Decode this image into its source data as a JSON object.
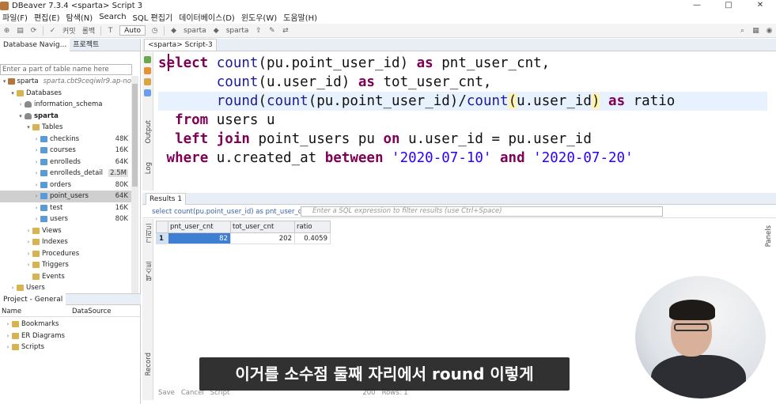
{
  "window": {
    "title": "DBeaver 7.3.4  <sparta> Script 3",
    "controls": [
      "—",
      "□",
      "✕"
    ]
  },
  "menu": [
    "파일(F)",
    "편집(E)",
    "탐색(N)",
    "Search",
    "SQL 편집기",
    "데이터베이스(D)",
    "윈도우(W)",
    "도움말(H)"
  ],
  "toolbar": {
    "commit_label": "커밋",
    "rollback_label": "롤백",
    "tx_mode": "Auto",
    "datasource": "sparta",
    "schema": "sparta"
  },
  "navigator": {
    "tabs": [
      "Database Navig...",
      "프로젝트"
    ],
    "filter_placeholder": "Enter a part of table name here",
    "tree": [
      {
        "level": 0,
        "arrow": "▾",
        "icon": "conn",
        "label": "sparta",
        "extra": "sparta.cbt9ceqiwlr9.ap-no",
        "size": ""
      },
      {
        "level": 1,
        "arrow": "▾",
        "icon": "folder",
        "label": "Databases",
        "size": ""
      },
      {
        "level": 2,
        "arrow": "›",
        "icon": "db",
        "label": "information_schema",
        "size": ""
      },
      {
        "level": 2,
        "arrow": "▾",
        "icon": "db",
        "label": "sparta",
        "size": ""
      },
      {
        "level": 3,
        "arrow": "▾",
        "icon": "folder",
        "label": "Tables",
        "size": ""
      },
      {
        "level": 4,
        "arrow": "›",
        "icon": "table",
        "label": "checkins",
        "size": "48K"
      },
      {
        "level": 4,
        "arrow": "›",
        "icon": "table",
        "label": "courses",
        "size": "16K"
      },
      {
        "level": 4,
        "arrow": "›",
        "icon": "table",
        "label": "enrolleds",
        "size": "64K"
      },
      {
        "level": 4,
        "arrow": "›",
        "icon": "table",
        "label": "enrolleds_detail",
        "size": "2.5M"
      },
      {
        "level": 4,
        "arrow": "›",
        "icon": "table",
        "label": "orders",
        "size": "80K"
      },
      {
        "level": 4,
        "arrow": "›",
        "icon": "table",
        "label": "point_users",
        "size": "64K"
      },
      {
        "level": 4,
        "arrow": "›",
        "icon": "table",
        "label": "test",
        "size": "16K"
      },
      {
        "level": 4,
        "arrow": "›",
        "icon": "table",
        "label": "users",
        "size": "80K"
      },
      {
        "level": 3,
        "arrow": "›",
        "icon": "folder",
        "label": "Views",
        "size": ""
      },
      {
        "level": 3,
        "arrow": "›",
        "icon": "folder",
        "label": "Indexes",
        "size": ""
      },
      {
        "level": 3,
        "arrow": "›",
        "icon": "folder",
        "label": "Procedures",
        "size": ""
      },
      {
        "level": 3,
        "arrow": "›",
        "icon": "folder",
        "label": "Triggers",
        "size": ""
      },
      {
        "level": 3,
        "arrow": "",
        "icon": "folder",
        "label": "Events",
        "size": ""
      },
      {
        "level": 1,
        "arrow": "›",
        "icon": "folder",
        "label": "Users",
        "size": ""
      }
    ]
  },
  "project": {
    "tab": "Project - General",
    "col_name": "Name",
    "col_ds": "DataSource",
    "items": [
      "Bookmarks",
      "ER Diagrams",
      "Scripts"
    ]
  },
  "editor": {
    "tab": "<sparta> Script-3",
    "side_labels": [
      "Output",
      "Log"
    ],
    "lines": [
      {
        "indent": "",
        "tokens": [
          [
            "kw",
            "select "
          ],
          [
            "fn",
            "count"
          ],
          [
            "id",
            "(pu.point_user_id) "
          ],
          [
            "kw",
            "as "
          ],
          [
            "id",
            "pnt_user_cnt,"
          ]
        ]
      },
      {
        "indent": "       ",
        "tokens": [
          [
            "fn",
            "count"
          ],
          [
            "id",
            "(u.user_id) "
          ],
          [
            "kw",
            "as "
          ],
          [
            "id",
            "tot_user_cnt,"
          ]
        ]
      },
      {
        "indent": "       ",
        "tokens": [
          [
            "fn",
            "round"
          ],
          [
            "id",
            "("
          ],
          [
            "fn",
            "count"
          ],
          [
            "id",
            "(pu.point_user_id)/"
          ],
          [
            "fn",
            "count"
          ],
          [
            "bracket",
            "("
          ],
          [
            "id",
            "u.user_id"
          ],
          [
            "bracket",
            ")"
          ],
          [
            "id",
            " "
          ],
          [
            "kw",
            "as "
          ],
          [
            "id",
            "ratio"
          ]
        ]
      },
      {
        "indent": "  ",
        "tokens": [
          [
            "kw",
            "from "
          ],
          [
            "id",
            "users u"
          ]
        ]
      },
      {
        "indent": "  ",
        "tokens": [
          [
            "kw",
            "left join "
          ],
          [
            "id",
            "point_users pu "
          ],
          [
            "kw",
            "on "
          ],
          [
            "id",
            "u.user_id = pu.user_id"
          ]
        ]
      },
      {
        "indent": " ",
        "tokens": [
          [
            "kw",
            "where "
          ],
          [
            "id",
            "u.created_at "
          ],
          [
            "kw",
            "between "
          ],
          [
            "str",
            "'2020-07-10'"
          ],
          [
            "id",
            " "
          ],
          [
            "kw",
            "and "
          ],
          [
            "str",
            "'2020-07-20'"
          ]
        ]
      }
    ]
  },
  "results": {
    "tab": "Results 1",
    "query_preview": "select count(pu.point_user_id) as pnt_user_cnt, count(u.user_id) as tot_user_cnt",
    "filter_placeholder": "Enter a SQL expression to filter results (use Ctrl+Space)",
    "side_labels": [
      "그리드",
      "텍스트",
      "Record"
    ],
    "right_label": "Panels",
    "columns": [
      "pnt_user_cnt",
      "tot_user_cnt",
      "ratio"
    ],
    "rows": [
      [
        "1",
        "82",
        "202",
        "0.4059"
      ]
    ],
    "status": [
      "Save",
      "Cancel",
      "Script",
      "200",
      "Rows: 1"
    ]
  },
  "subtitle": "이거를 소수점 둘째 자리에서 round 이렇게"
}
